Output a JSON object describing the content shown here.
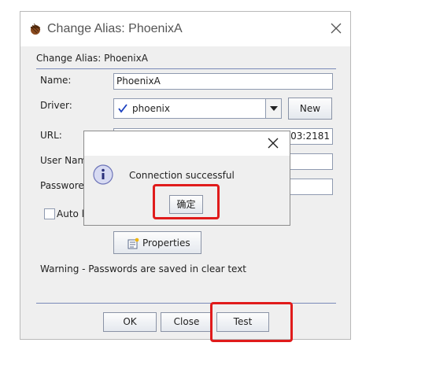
{
  "window": {
    "title": "Change Alias: PhoenixA",
    "panel_title": "Change Alias: PhoenixA"
  },
  "form": {
    "name_label": "Name:",
    "name_value": "PhoenixA",
    "driver_label": "Driver:",
    "driver_value": "phoenix",
    "new_button": "New",
    "url_label": "URL:",
    "url_value": "103:2181",
    "user_label": "User Nam",
    "password_label": "Passwore",
    "auto_label": "Auto lo",
    "properties_button": "Properties",
    "warning_text": "Warning - Passwords are saved in clear text"
  },
  "buttons": {
    "ok": "OK",
    "close": "Close",
    "test": "Test"
  },
  "dialog": {
    "message": "Connection successful",
    "confirm_button": "确定"
  },
  "colors": {
    "highlight": "#e01b1b",
    "separator": "#7a8ab8",
    "check": "#1a3fbf"
  },
  "icons": [
    "acorn-icon",
    "close-icon",
    "checkmark-icon",
    "dropdown-arrow-icon",
    "properties-icon",
    "info-icon"
  ]
}
